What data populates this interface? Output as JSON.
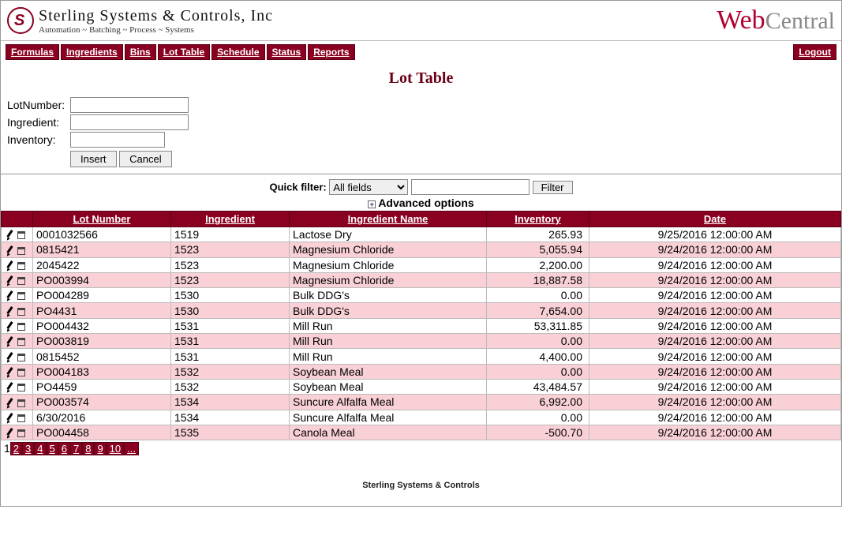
{
  "header": {
    "company_name": "Sterling Systems & Controls, Inc",
    "company_tag": "Automation ~ Batching ~ Process ~ Systems",
    "app_brand_web": "Web",
    "app_brand_central": "Central"
  },
  "nav": {
    "tabs": [
      "Formulas",
      "Ingredients",
      "Bins",
      "Lot Table",
      "Schedule",
      "Status",
      "Reports"
    ],
    "logout_label": "Logout"
  },
  "page_title": "Lot Table",
  "form": {
    "lotnumber_label": "LotNumber:",
    "ingredient_label": "Ingredient:",
    "inventory_label": "Inventory:",
    "lotnumber_value": "",
    "ingredient_value": "",
    "inventory_value": "",
    "insert_label": "Insert",
    "cancel_label": "Cancel"
  },
  "filter": {
    "quick_filter_label": "Quick filter:",
    "field_selected": "All fields",
    "field_options": [
      "All fields"
    ],
    "text_value": "",
    "filter_btn": "Filter",
    "advanced_label": "Advanced options"
  },
  "table": {
    "headers": [
      "",
      "Lot Number",
      "Ingredient",
      "Ingredient Name",
      "Inventory",
      "Date"
    ],
    "rows": [
      {
        "lot": "0001032566",
        "ing": "1519",
        "name": "Lactose Dry",
        "inv": "265.93",
        "date": "9/25/2016 12:00:00 AM"
      },
      {
        "lot": "0815421",
        "ing": "1523",
        "name": "Magnesium Chloride",
        "inv": "5,055.94",
        "date": "9/24/2016 12:00:00 AM"
      },
      {
        "lot": "2045422",
        "ing": "1523",
        "name": "Magnesium Chloride",
        "inv": "2,200.00",
        "date": "9/24/2016 12:00:00 AM"
      },
      {
        "lot": "PO003994",
        "ing": "1523",
        "name": "Magnesium Chloride",
        "inv": "18,887.58",
        "date": "9/24/2016 12:00:00 AM"
      },
      {
        "lot": "PO004289",
        "ing": "1530",
        "name": "Bulk DDG's",
        "inv": "0.00",
        "date": "9/24/2016 12:00:00 AM"
      },
      {
        "lot": "PO4431",
        "ing": "1530",
        "name": "Bulk DDG's",
        "inv": "7,654.00",
        "date": "9/24/2016 12:00:00 AM"
      },
      {
        "lot": "PO004432",
        "ing": "1531",
        "name": "Mill Run",
        "inv": "53,311.85",
        "date": "9/24/2016 12:00:00 AM"
      },
      {
        "lot": "PO003819",
        "ing": "1531",
        "name": "Mill Run",
        "inv": "0.00",
        "date": "9/24/2016 12:00:00 AM"
      },
      {
        "lot": "0815452",
        "ing": "1531",
        "name": "Mill Run",
        "inv": "4,400.00",
        "date": "9/24/2016 12:00:00 AM"
      },
      {
        "lot": "PO004183",
        "ing": "1532",
        "name": "Soybean Meal",
        "inv": "0.00",
        "date": "9/24/2016 12:00:00 AM"
      },
      {
        "lot": "PO4459",
        "ing": "1532",
        "name": "Soybean Meal",
        "inv": "43,484.57",
        "date": "9/24/2016 12:00:00 AM"
      },
      {
        "lot": "PO003574",
        "ing": "1534",
        "name": "Suncure Alfalfa Meal",
        "inv": "6,992.00",
        "date": "9/24/2016 12:00:00 AM"
      },
      {
        "lot": "6/30/2016",
        "ing": "1534",
        "name": "Suncure Alfalfa Meal",
        "inv": "0.00",
        "date": "9/24/2016 12:00:00 AM"
      },
      {
        "lot": "PO004458",
        "ing": "1535",
        "name": "Canola Meal",
        "inv": "-500.70",
        "date": "9/24/2016 12:00:00 AM"
      }
    ]
  },
  "pager": {
    "current": "1",
    "pages": [
      "2",
      "3",
      "4",
      "5",
      "6",
      "7",
      "8",
      "9",
      "10",
      "..."
    ]
  },
  "footer": "Sterling Systems & Controls"
}
